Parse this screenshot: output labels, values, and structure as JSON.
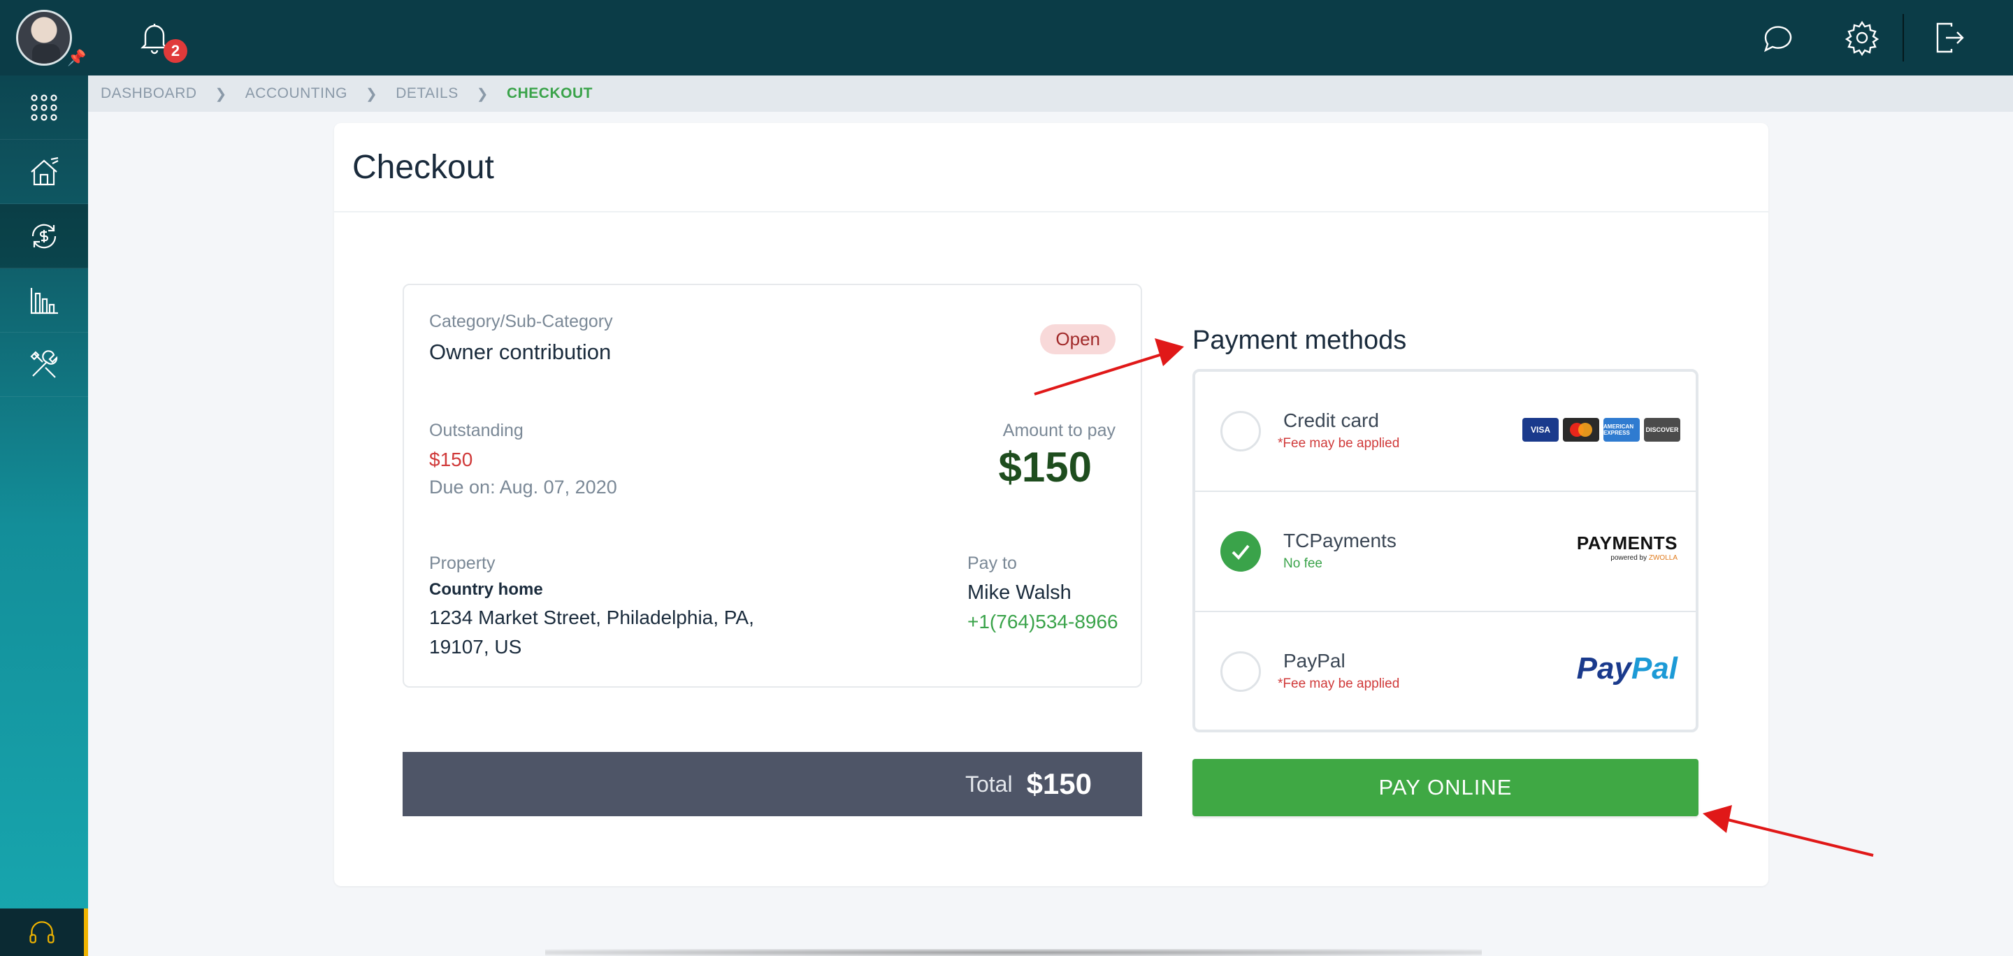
{
  "topbar": {
    "notification_count": "2"
  },
  "icons": {
    "bell": "bell-icon",
    "chat": "chat-icon",
    "settings": "gear-icon",
    "logout": "logout-icon"
  },
  "sidebar": {
    "items": [
      {
        "icon": "apps-grid-icon"
      },
      {
        "icon": "property-icon"
      },
      {
        "icon": "accounting-icon"
      },
      {
        "icon": "reports-icon"
      },
      {
        "icon": "tools-icon"
      }
    ]
  },
  "breadcrumb": {
    "items": [
      "DASHBOARD",
      "ACCOUNTING",
      "DETAILS",
      "CHECKOUT"
    ]
  },
  "page": {
    "title": "Checkout"
  },
  "details": {
    "category_label": "Category/Sub-Category",
    "category_value": "Owner contribution",
    "status": "Open",
    "outstanding_label": "Outstanding",
    "outstanding_value": "$150",
    "due_on": "Due on: Aug. 07, 2020",
    "amount_label": "Amount to pay",
    "amount_value": "$150",
    "property_label": "Property",
    "property_name": "Country home",
    "property_address_1": "1234 Market Street, Philadelphia, PA,",
    "property_address_2": "19107, US",
    "payto_label": "Pay to",
    "payto_name": "Mike Walsh",
    "payto_phone": "+1(764)534-8966"
  },
  "total": {
    "label": "Total",
    "value": "$150"
  },
  "payment_methods": {
    "title": "Payment methods",
    "options": [
      {
        "name": "Credit card",
        "note": "Fee may be applied",
        "asterisk": "*",
        "selected": false
      },
      {
        "name": "TCPayments",
        "note": "No fee",
        "selected": true
      },
      {
        "name": "PayPal",
        "note": "Fee may be applied",
        "asterisk": "*",
        "selected": false
      }
    ],
    "logos": {
      "visa": "VISA",
      "amex": "AMERICAN EXPRESS",
      "discover": "DISCOVER",
      "payments_main": "PAYMENTS",
      "payments_sub_prefix": "powered by",
      "payments_sub_brand": "ZWOLLA",
      "paypal_pay": "Pay",
      "paypal_pal": "Pal"
    }
  },
  "actions": {
    "pay_online": "PAY ONLINE"
  },
  "colors": {
    "accent_green": "#3fa844",
    "header_dark": "#0b3c47",
    "alert_red": "#d03a3a",
    "amount_dark_green": "#1e4d1e"
  }
}
